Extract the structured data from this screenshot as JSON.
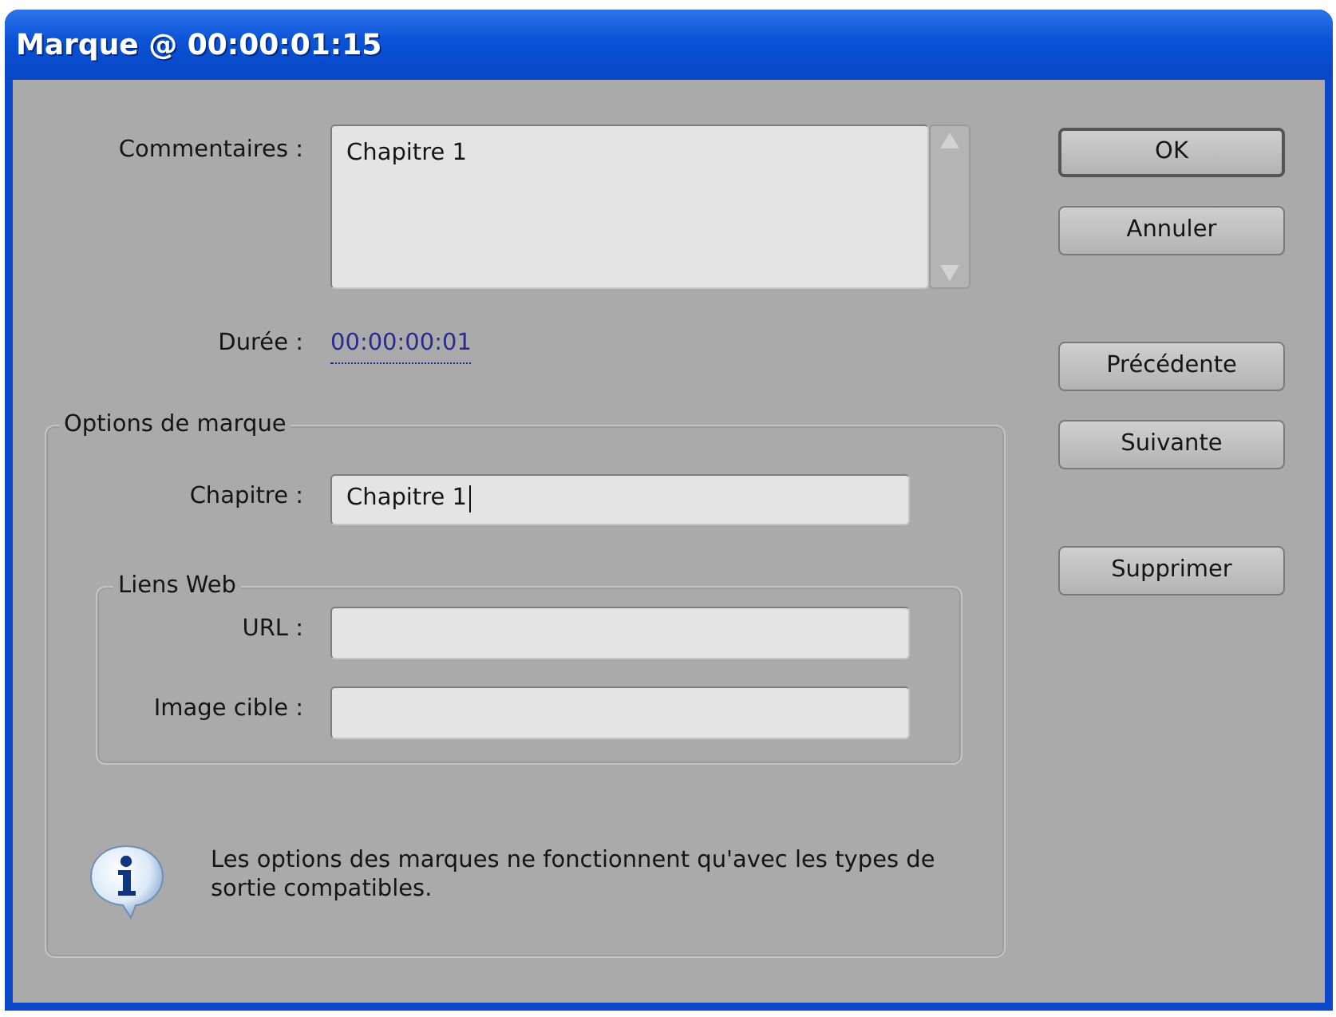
{
  "window": {
    "title": "Marque @ 00:00:01:15"
  },
  "comments": {
    "label": "Commentaires :",
    "value": "Chapitre 1"
  },
  "duration": {
    "label": "Durée :",
    "value": "00:00:00:01"
  },
  "marker_options": {
    "title": "Options de marque",
    "chapter": {
      "label": "Chapitre :",
      "value": "Chapitre 1",
      "focused": true
    },
    "web_links": {
      "title": "Liens Web",
      "fields": [
        {
          "label": "URL :",
          "focused": false
        },
        {
          "label": "Image cible :",
          "focused": false
        }
      ]
    },
    "note": {
      "text": "Les options des marques ne fonctionnent qu'avec les types de sortie compatibles."
    }
  },
  "button_groups": [
    [
      {
        "label": "OK",
        "default": true
      },
      {
        "label": "Annuler",
        "default": false
      }
    ],
    [
      {
        "label": "Précédente",
        "default": false
      },
      {
        "label": "Suivante",
        "default": false
      }
    ],
    [
      {
        "label": "Supprimer",
        "default": false
      }
    ]
  ]
}
